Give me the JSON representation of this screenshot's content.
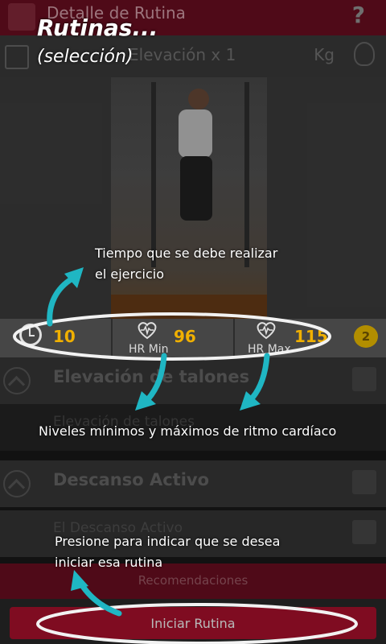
{
  "app": {
    "title": "Detalle de Rutina",
    "help_icon": "?",
    "exercise_short": "Elevación x 1",
    "unit": "Kg"
  },
  "stats": {
    "time_value": "10",
    "hr_min_value": "96",
    "hr_min_label": "HR Min",
    "hr_max_value": "115",
    "hr_max_label": "HR Max",
    "badge": "2"
  },
  "list": {
    "items": [
      {
        "label": "Elevación de talones"
      },
      {
        "label": "Elevación de talones"
      },
      {
        "label": "Descanso Activo"
      },
      {
        "label": "El Descanso Activo"
      }
    ]
  },
  "footer": {
    "recommendations_label": "Recomendaciones",
    "start_label": "Iniciar Rutina"
  },
  "annotations": {
    "title": "Rutinas...",
    "subtitle": "(selección)",
    "time_note_line1": "Tiempo que se debe realizar",
    "time_note_line2": "el ejercicio",
    "hr_note": "Niveles mínimos y máximos de ritmo cardíaco",
    "start_note_line1": "Presione para indicar que se desea",
    "start_note_line2": "iniciar esa rutina"
  },
  "colors": {
    "brand": "#6e0f22",
    "button": "#b0112e",
    "accent_value": "#f0b000",
    "arrow": "#1fb6c3"
  }
}
